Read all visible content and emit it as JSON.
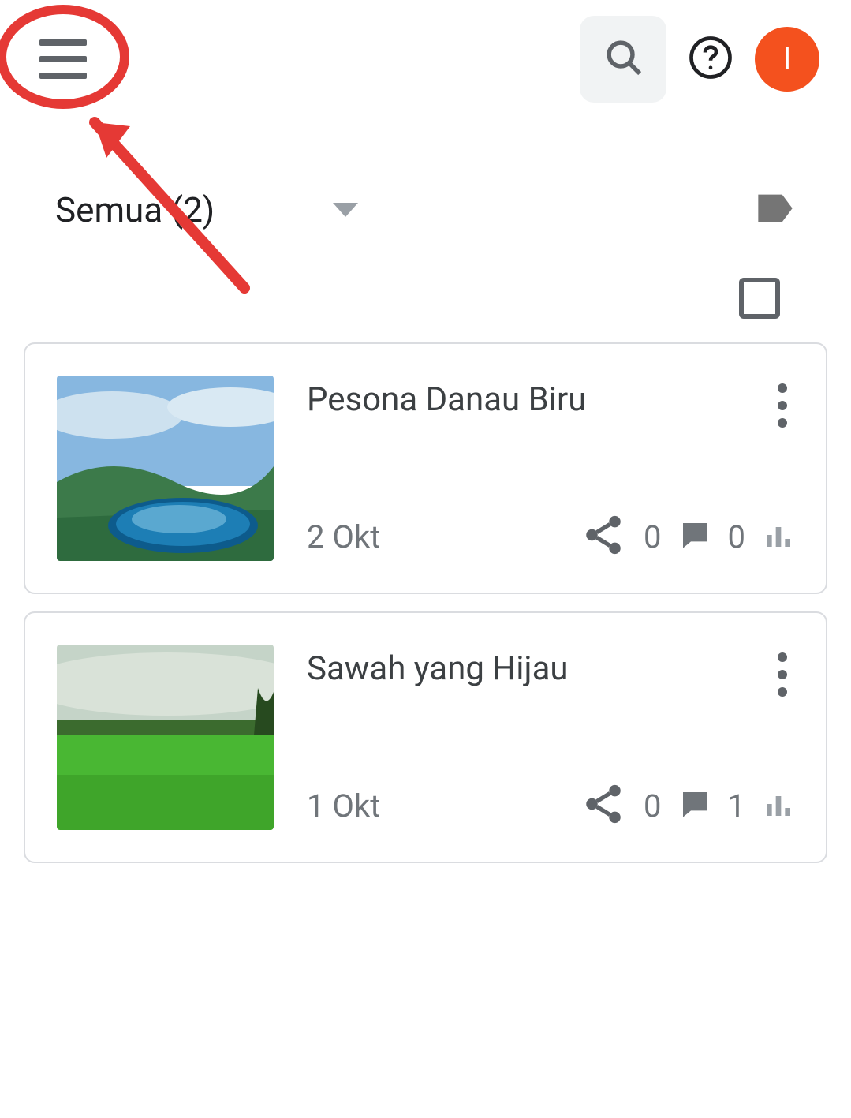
{
  "header": {
    "avatar_initial": "I"
  },
  "filter": {
    "label": "Semua (2)"
  },
  "posts": [
    {
      "title": "Pesona Danau Biru",
      "date": "2 Okt",
      "comments": "0",
      "views": "0"
    },
    {
      "title": "Sawah yang Hijau",
      "date": "1 Okt",
      "comments": "0",
      "views": "1"
    }
  ]
}
